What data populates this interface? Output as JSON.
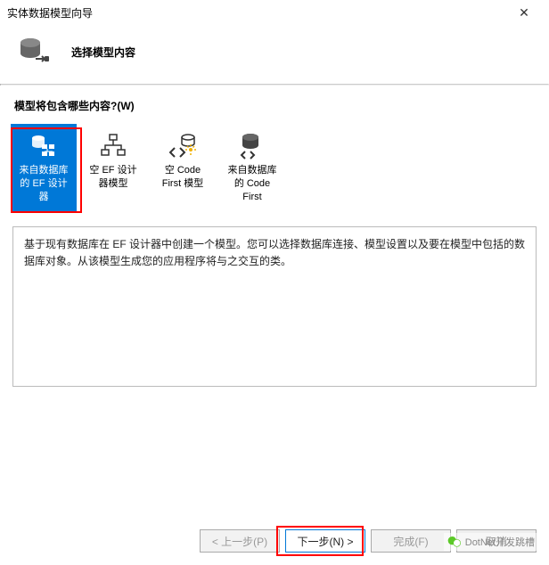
{
  "window": {
    "title": "实体数据模型向导",
    "close_glyph": "✕"
  },
  "header": {
    "title": "选择模型内容"
  },
  "section_label": "模型将包含哪些内容?(W)",
  "options": [
    {
      "label": "来自数据库的 EF 设计器",
      "selected": true
    },
    {
      "label": "空 EF 设计器模型",
      "selected": false
    },
    {
      "label": "空 Code First 模型",
      "selected": false
    },
    {
      "label": "来自数据库的 Code First",
      "selected": false
    }
  ],
  "description": "基于现有数据库在 EF 设计器中创建一个模型。您可以选择数据库连接、模型设置以及要在模型中包括的数据库对象。从该模型生成您的应用程序将与之交互的类。",
  "buttons": {
    "previous": "< 上一步(P)",
    "next": "下一步(N) >",
    "finish": "完成(F)",
    "cancel": "取消"
  },
  "watermark": "DotNet开发跳槽"
}
